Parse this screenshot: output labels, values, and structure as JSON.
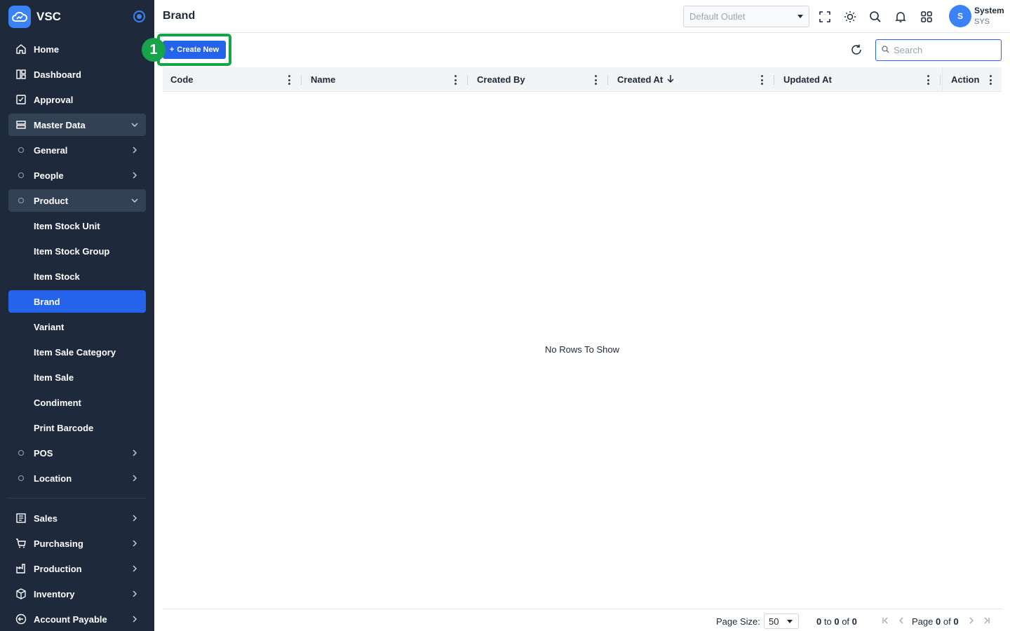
{
  "app": {
    "name": "VSC",
    "logo_icon": "cloud-icon"
  },
  "sidebar": {
    "items": [
      {
        "label": "Home",
        "icon": "home-icon"
      },
      {
        "label": "Dashboard",
        "icon": "dashboard-icon"
      },
      {
        "label": "Approval",
        "icon": "approval-icon"
      },
      {
        "label": "Master Data",
        "icon": "server-icon",
        "expanded": true
      },
      {
        "label": "General"
      },
      {
        "label": "People"
      },
      {
        "label": "Product",
        "expanded": true
      },
      {
        "label": "Item Stock Unit"
      },
      {
        "label": "Item Stock Group"
      },
      {
        "label": "Item Stock"
      },
      {
        "label": "Brand",
        "active": true
      },
      {
        "label": "Variant"
      },
      {
        "label": "Item Sale Category"
      },
      {
        "label": "Item Sale"
      },
      {
        "label": "Condiment"
      },
      {
        "label": "Print Barcode"
      },
      {
        "label": "POS"
      },
      {
        "label": "Location"
      },
      {
        "label": "Sales",
        "icon": "sales-icon"
      },
      {
        "label": "Purchasing",
        "icon": "cart-icon"
      },
      {
        "label": "Production",
        "icon": "factory-icon"
      },
      {
        "label": "Inventory",
        "icon": "box-icon"
      },
      {
        "label": "Account Payable",
        "icon": "arrow-left-circle-icon"
      }
    ]
  },
  "header": {
    "title": "Brand",
    "outlet_placeholder": "Default Outlet",
    "user": {
      "initial": "S",
      "name": "System",
      "code": "SYS"
    }
  },
  "toolbar": {
    "create_label": "Create New",
    "step_number": "1",
    "search_placeholder": "Search"
  },
  "grid": {
    "columns": [
      {
        "label": "Code"
      },
      {
        "label": "Name"
      },
      {
        "label": "Created By"
      },
      {
        "label": "Created At",
        "sort": "desc"
      },
      {
        "label": "Updated At"
      },
      {
        "label": "Action"
      }
    ],
    "empty_text": "No Rows To Show"
  },
  "pagination": {
    "page_size_label": "Page Size:",
    "page_size": "50",
    "range_from": "0",
    "range_to_word": "to",
    "range_to": "0",
    "of_word": "of",
    "total": "0",
    "page_word": "Page",
    "page_current": "0",
    "page_total": "0"
  },
  "colors": {
    "sidebar_bg": "#1e293b",
    "accent": "#2563eb",
    "highlight": "#16a34a"
  }
}
